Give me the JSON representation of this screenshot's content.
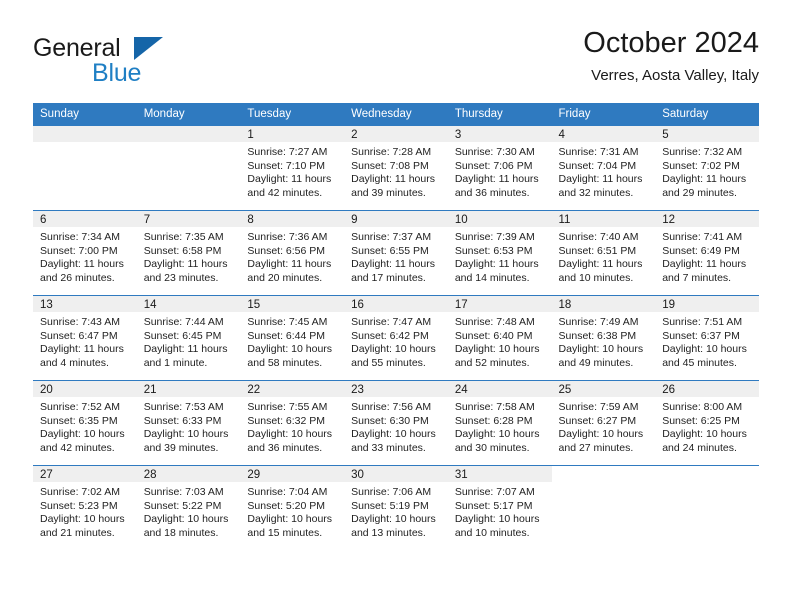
{
  "brand": {
    "name_part1": "General",
    "name_part2": "Blue",
    "colors": {
      "dark": "#1a1a1a",
      "blue": "#1f7fc4",
      "triangle": "#1565a8"
    }
  },
  "header": {
    "month_title": "October 2024",
    "location": "Verres, Aosta Valley, Italy"
  },
  "theme": {
    "header_row_bg": "#2f7ac0",
    "day_strip_bg": "#efefef",
    "grid_line": "#2f7ac0"
  },
  "weekdays": [
    "Sunday",
    "Monday",
    "Tuesday",
    "Wednesday",
    "Thursday",
    "Friday",
    "Saturday"
  ],
  "labels": {
    "sunrise_prefix": "Sunrise:",
    "sunset_prefix": "Sunset:",
    "daylight_prefix": "Daylight:"
  },
  "weeks": [
    [
      {
        "day": "",
        "empty": true
      },
      {
        "day": "",
        "empty": true
      },
      {
        "day": "1",
        "sunrise": "Sunrise: 7:27 AM",
        "sunset": "Sunset: 7:10 PM",
        "daylight_line1": "Daylight: 11 hours",
        "daylight_line2": "and 42 minutes."
      },
      {
        "day": "2",
        "sunrise": "Sunrise: 7:28 AM",
        "sunset": "Sunset: 7:08 PM",
        "daylight_line1": "Daylight: 11 hours",
        "daylight_line2": "and 39 minutes."
      },
      {
        "day": "3",
        "sunrise": "Sunrise: 7:30 AM",
        "sunset": "Sunset: 7:06 PM",
        "daylight_line1": "Daylight: 11 hours",
        "daylight_line2": "and 36 minutes."
      },
      {
        "day": "4",
        "sunrise": "Sunrise: 7:31 AM",
        "sunset": "Sunset: 7:04 PM",
        "daylight_line1": "Daylight: 11 hours",
        "daylight_line2": "and 32 minutes."
      },
      {
        "day": "5",
        "sunrise": "Sunrise: 7:32 AM",
        "sunset": "Sunset: 7:02 PM",
        "daylight_line1": "Daylight: 11 hours",
        "daylight_line2": "and 29 minutes."
      }
    ],
    [
      {
        "day": "6",
        "sunrise": "Sunrise: 7:34 AM",
        "sunset": "Sunset: 7:00 PM",
        "daylight_line1": "Daylight: 11 hours",
        "daylight_line2": "and 26 minutes."
      },
      {
        "day": "7",
        "sunrise": "Sunrise: 7:35 AM",
        "sunset": "Sunset: 6:58 PM",
        "daylight_line1": "Daylight: 11 hours",
        "daylight_line2": "and 23 minutes."
      },
      {
        "day": "8",
        "sunrise": "Sunrise: 7:36 AM",
        "sunset": "Sunset: 6:56 PM",
        "daylight_line1": "Daylight: 11 hours",
        "daylight_line2": "and 20 minutes."
      },
      {
        "day": "9",
        "sunrise": "Sunrise: 7:37 AM",
        "sunset": "Sunset: 6:55 PM",
        "daylight_line1": "Daylight: 11 hours",
        "daylight_line2": "and 17 minutes."
      },
      {
        "day": "10",
        "sunrise": "Sunrise: 7:39 AM",
        "sunset": "Sunset: 6:53 PM",
        "daylight_line1": "Daylight: 11 hours",
        "daylight_line2": "and 14 minutes."
      },
      {
        "day": "11",
        "sunrise": "Sunrise: 7:40 AM",
        "sunset": "Sunset: 6:51 PM",
        "daylight_line1": "Daylight: 11 hours",
        "daylight_line2": "and 10 minutes."
      },
      {
        "day": "12",
        "sunrise": "Sunrise: 7:41 AM",
        "sunset": "Sunset: 6:49 PM",
        "daylight_line1": "Daylight: 11 hours",
        "daylight_line2": "and 7 minutes."
      }
    ],
    [
      {
        "day": "13",
        "sunrise": "Sunrise: 7:43 AM",
        "sunset": "Sunset: 6:47 PM",
        "daylight_line1": "Daylight: 11 hours",
        "daylight_line2": "and 4 minutes."
      },
      {
        "day": "14",
        "sunrise": "Sunrise: 7:44 AM",
        "sunset": "Sunset: 6:45 PM",
        "daylight_line1": "Daylight: 11 hours",
        "daylight_line2": "and 1 minute."
      },
      {
        "day": "15",
        "sunrise": "Sunrise: 7:45 AM",
        "sunset": "Sunset: 6:44 PM",
        "daylight_line1": "Daylight: 10 hours",
        "daylight_line2": "and 58 minutes."
      },
      {
        "day": "16",
        "sunrise": "Sunrise: 7:47 AM",
        "sunset": "Sunset: 6:42 PM",
        "daylight_line1": "Daylight: 10 hours",
        "daylight_line2": "and 55 minutes."
      },
      {
        "day": "17",
        "sunrise": "Sunrise: 7:48 AM",
        "sunset": "Sunset: 6:40 PM",
        "daylight_line1": "Daylight: 10 hours",
        "daylight_line2": "and 52 minutes."
      },
      {
        "day": "18",
        "sunrise": "Sunrise: 7:49 AM",
        "sunset": "Sunset: 6:38 PM",
        "daylight_line1": "Daylight: 10 hours",
        "daylight_line2": "and 49 minutes."
      },
      {
        "day": "19",
        "sunrise": "Sunrise: 7:51 AM",
        "sunset": "Sunset: 6:37 PM",
        "daylight_line1": "Daylight: 10 hours",
        "daylight_line2": "and 45 minutes."
      }
    ],
    [
      {
        "day": "20",
        "sunrise": "Sunrise: 7:52 AM",
        "sunset": "Sunset: 6:35 PM",
        "daylight_line1": "Daylight: 10 hours",
        "daylight_line2": "and 42 minutes."
      },
      {
        "day": "21",
        "sunrise": "Sunrise: 7:53 AM",
        "sunset": "Sunset: 6:33 PM",
        "daylight_line1": "Daylight: 10 hours",
        "daylight_line2": "and 39 minutes."
      },
      {
        "day": "22",
        "sunrise": "Sunrise: 7:55 AM",
        "sunset": "Sunset: 6:32 PM",
        "daylight_line1": "Daylight: 10 hours",
        "daylight_line2": "and 36 minutes."
      },
      {
        "day": "23",
        "sunrise": "Sunrise: 7:56 AM",
        "sunset": "Sunset: 6:30 PM",
        "daylight_line1": "Daylight: 10 hours",
        "daylight_line2": "and 33 minutes."
      },
      {
        "day": "24",
        "sunrise": "Sunrise: 7:58 AM",
        "sunset": "Sunset: 6:28 PM",
        "daylight_line1": "Daylight: 10 hours",
        "daylight_line2": "and 30 minutes."
      },
      {
        "day": "25",
        "sunrise": "Sunrise: 7:59 AM",
        "sunset": "Sunset: 6:27 PM",
        "daylight_line1": "Daylight: 10 hours",
        "daylight_line2": "and 27 minutes."
      },
      {
        "day": "26",
        "sunrise": "Sunrise: 8:00 AM",
        "sunset": "Sunset: 6:25 PM",
        "daylight_line1": "Daylight: 10 hours",
        "daylight_line2": "and 24 minutes."
      }
    ],
    [
      {
        "day": "27",
        "sunrise": "Sunrise: 7:02 AM",
        "sunset": "Sunset: 5:23 PM",
        "daylight_line1": "Daylight: 10 hours",
        "daylight_line2": "and 21 minutes."
      },
      {
        "day": "28",
        "sunrise": "Sunrise: 7:03 AM",
        "sunset": "Sunset: 5:22 PM",
        "daylight_line1": "Daylight: 10 hours",
        "daylight_line2": "and 18 minutes."
      },
      {
        "day": "29",
        "sunrise": "Sunrise: 7:04 AM",
        "sunset": "Sunset: 5:20 PM",
        "daylight_line1": "Daylight: 10 hours",
        "daylight_line2": "and 15 minutes."
      },
      {
        "day": "30",
        "sunrise": "Sunrise: 7:06 AM",
        "sunset": "Sunset: 5:19 PM",
        "daylight_line1": "Daylight: 10 hours",
        "daylight_line2": "and 13 minutes."
      },
      {
        "day": "31",
        "sunrise": "Sunrise: 7:07 AM",
        "sunset": "Sunset: 5:17 PM",
        "daylight_line1": "Daylight: 10 hours",
        "daylight_line2": "and 10 minutes."
      },
      {
        "day": "",
        "empty": true,
        "no_strip": true
      },
      {
        "day": "",
        "empty": true,
        "no_strip": true
      }
    ]
  ]
}
